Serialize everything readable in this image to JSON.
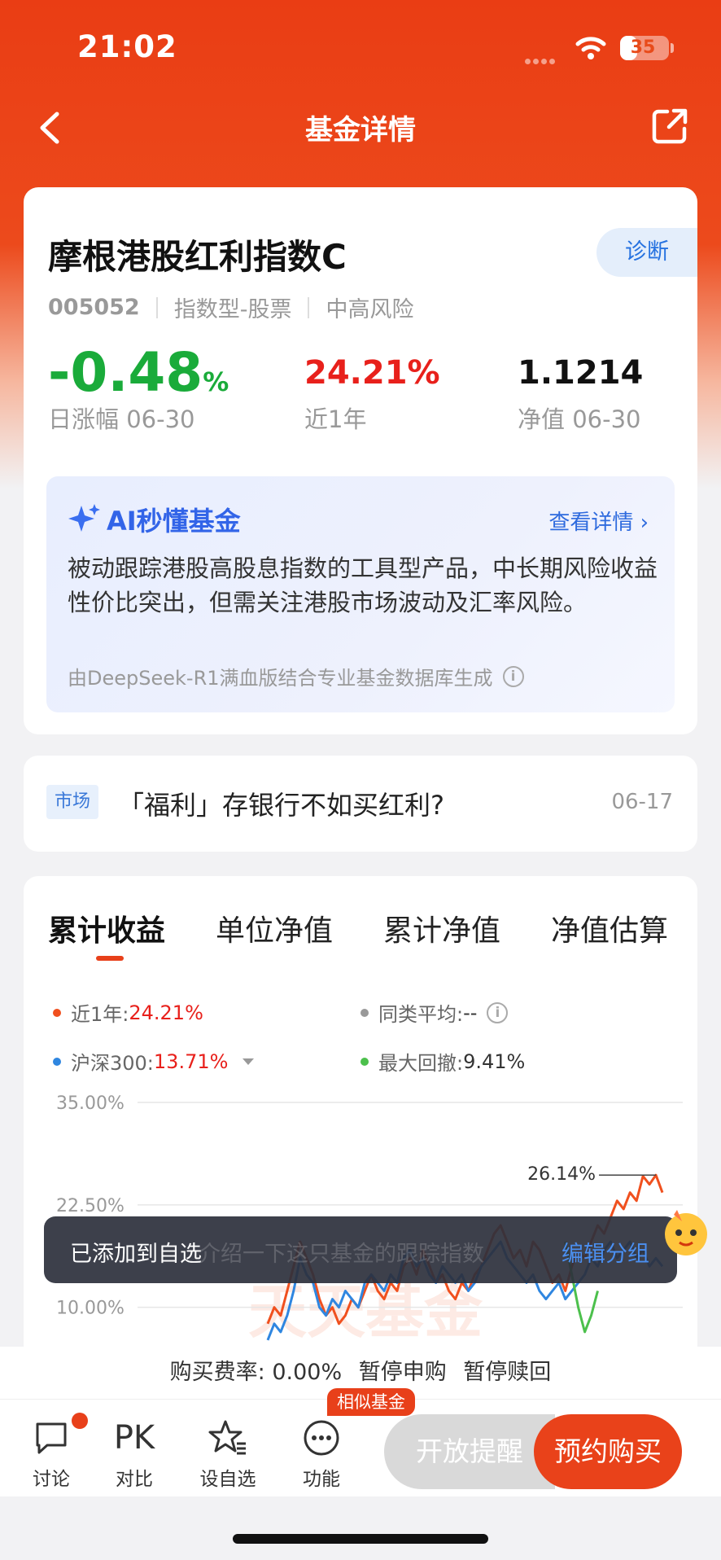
{
  "status": {
    "time": "21:02",
    "battery": "35",
    "battery_level": 0.35
  },
  "nav": {
    "title": "基金详情"
  },
  "fund": {
    "name": "摩根港股红利指数C",
    "diagnose_label": "诊断",
    "code": "005052",
    "type": "指数型-股票",
    "risk": "中高风险",
    "day_change": "-0.48",
    "day_change_unit": "%",
    "day_change_label": "日涨幅 06-30",
    "year_return": "24.21%",
    "year_return_label": "近1年",
    "nav_value": "1.1214",
    "nav_label": "净值 06-30"
  },
  "ai": {
    "title": "AI秒懂基金",
    "more": "查看详情 ›",
    "text": "被动跟踪港股高股息指数的工具型产品，中长期风险收益性价比突出，但需关注港股市场波动及汇率风险。",
    "footnote": "由DeepSeek-R1满血版结合专业基金数据库生成"
  },
  "news": {
    "tag": "市场",
    "title": "「福利」存银行不如买红利?",
    "date": "06-17"
  },
  "chart": {
    "tabs": [
      "累计收益",
      "单位净值",
      "累计净值",
      "净值估算"
    ],
    "active_tab": 0,
    "legend": [
      {
        "label": "近1年: ",
        "value": "24.21%",
        "color": "#f0501e"
      },
      {
        "label": "同类平均: ",
        "value": "--",
        "color": "#999999"
      },
      {
        "label": "沪深300: ",
        "value": "13.71%",
        "color": "#2f86e0"
      },
      {
        "label": "最大回撤: ",
        "value": "9.41%",
        "color": "#4cc04c"
      }
    ],
    "watermark": "天天基金"
  },
  "chart_data": {
    "type": "line",
    "ytick_labels": [
      "35.00%",
      "22.50%",
      "10.00%"
    ],
    "yticks": [
      35.0,
      22.5,
      10.0
    ],
    "ylim": [
      5,
      35
    ],
    "peak_annotation": "26.14%",
    "series": [
      {
        "name": "近1年",
        "color": "#f0501e",
        "values": [
          8,
          10,
          9,
          12,
          15,
          18,
          16,
          14,
          11,
          9,
          10,
          8,
          9,
          11,
          10,
          12,
          14,
          12,
          11,
          13,
          12,
          15,
          16,
          14,
          17,
          15,
          13,
          14,
          12,
          11,
          13,
          12,
          14,
          15,
          17,
          19,
          20,
          18,
          16,
          17,
          15,
          18,
          17,
          15,
          13,
          14,
          12,
          15,
          17,
          16,
          18,
          20,
          19,
          21,
          23,
          22,
          24,
          23,
          26,
          25,
          26.14,
          24
        ]
      },
      {
        "name": "沪深300",
        "color": "#2f86e0",
        "values": [
          6,
          8,
          7,
          9,
          12,
          16,
          14,
          13,
          10,
          9,
          11,
          10,
          12,
          11,
          10,
          13,
          14,
          13,
          12,
          14,
          13,
          16,
          17,
          15,
          16,
          14,
          13,
          15,
          14,
          13,
          14,
          12,
          13,
          15,
          16,
          17,
          18,
          16,
          15,
          14,
          13,
          14,
          12,
          11,
          12,
          13,
          11,
          12,
          13,
          14,
          16,
          15,
          17,
          18,
          16,
          17,
          18,
          16,
          17,
          15,
          16,
          15
        ]
      },
      {
        "name": "最大回撤",
        "color": "#4cc04c",
        "values": [
          null,
          null,
          null,
          null,
          null,
          null,
          null,
          null,
          null,
          null,
          null,
          null,
          null,
          null,
          null,
          null,
          null,
          null,
          null,
          null,
          null,
          null,
          null,
          null,
          null,
          null,
          null,
          null,
          null,
          null,
          null,
          null,
          null,
          null,
          null,
          null,
          null,
          null,
          null,
          null,
          null,
          null,
          null,
          null,
          null,
          null,
          18,
          14,
          10,
          7,
          9,
          12,
          null,
          null,
          null,
          null,
          null,
          null,
          null,
          null,
          null,
          null
        ]
      }
    ]
  },
  "toast": {
    "message": "已添加到自选",
    "ghost": "介绍一下这只基金的跟踪指数",
    "action": "编辑分组"
  },
  "fee": {
    "rate": "购买费率:  0.00%",
    "subscribe": "暂停申购",
    "redeem": "暂停赎回"
  },
  "bottom": {
    "items": [
      {
        "label": "讨论",
        "icon": "chat-icon"
      },
      {
        "label": "对比",
        "icon": "PK"
      },
      {
        "label": "设自选",
        "icon": "star-icon"
      },
      {
        "label": "功能",
        "icon": "more-icon"
      }
    ],
    "similar_badge": "相似基金",
    "remind": "开放提醒",
    "buy": "预约购买"
  }
}
